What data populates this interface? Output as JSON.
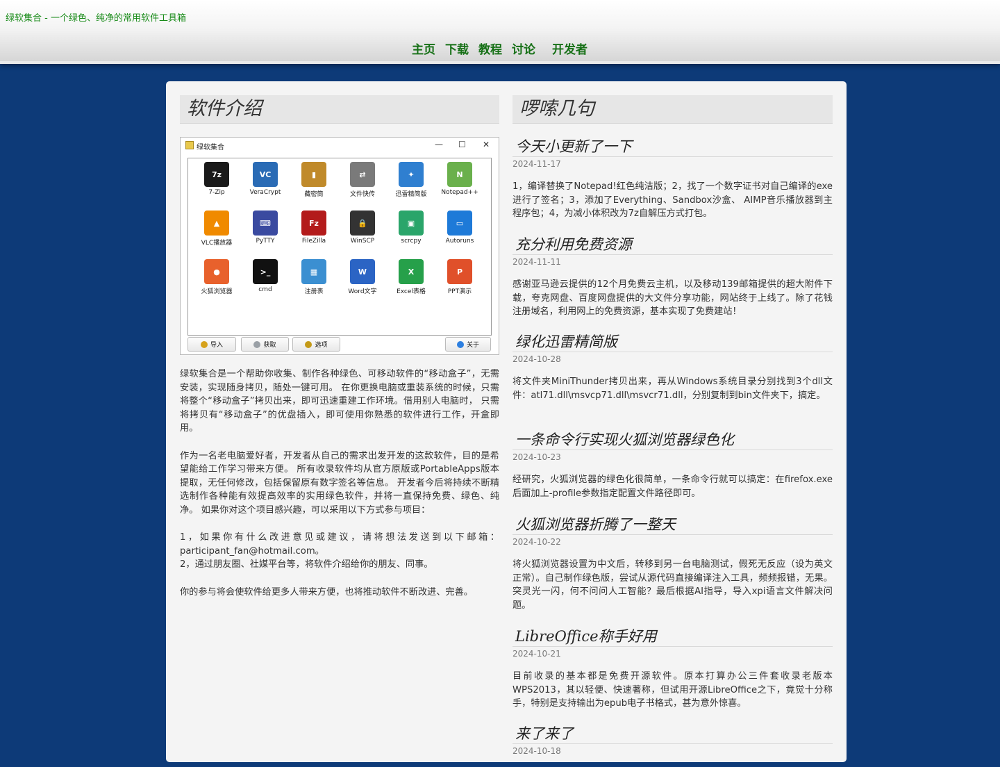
{
  "site": {
    "title": "绿软集合 - 一个绿色、纯净的常用软件工具箱",
    "nav": [
      "主页",
      "下载",
      "教程",
      "讨论",
      "开发者"
    ]
  },
  "left": {
    "heading": "软件介绍",
    "app": {
      "window_title": "绿软集合",
      "controls": [
        "—",
        "☐",
        "✕"
      ],
      "items": [
        {
          "label": "7-Zip",
          "icon": "7zip-icon",
          "color": "#1a1a1a",
          "glyph": "7z"
        },
        {
          "label": "VeraCrypt",
          "icon": "veracrypt-icon",
          "color": "#2a6bb5",
          "glyph": "VC"
        },
        {
          "label": "藏密筒",
          "icon": "safe-icon",
          "color": "#c08a2a",
          "glyph": "▮"
        },
        {
          "label": "文件快传",
          "icon": "file-transfer-icon",
          "color": "#7a7a7a",
          "glyph": "⇄"
        },
        {
          "label": "迅雷精简版",
          "icon": "thunder-bird-icon",
          "color": "#2f7fd0",
          "glyph": "✦"
        },
        {
          "label": "Notepad++",
          "icon": "notepad-icon",
          "color": "#6ab04c",
          "glyph": "N"
        },
        {
          "label": "VLC播放器",
          "icon": "vlc-cone-icon",
          "color": "#f08a00",
          "glyph": "▲"
        },
        {
          "label": "PyTTY",
          "icon": "terminal-icon",
          "color": "#3a4aa0",
          "glyph": "⌨"
        },
        {
          "label": "FileZilla",
          "icon": "filezilla-icon",
          "color": "#b31b1b",
          "glyph": "Fz"
        },
        {
          "label": "WinSCP",
          "icon": "lock-icon",
          "color": "#333333",
          "glyph": "🔒"
        },
        {
          "label": "scrcpy",
          "icon": "android-icon",
          "color": "#2aa56a",
          "glyph": "▣"
        },
        {
          "label": "Autoruns",
          "icon": "autoruns-icon",
          "color": "#1e7ad8",
          "glyph": "▭"
        },
        {
          "label": "火狐浏览器",
          "icon": "firefox-icon",
          "color": "#e8612c",
          "glyph": "●"
        },
        {
          "label": "cmd",
          "icon": "cmd-icon",
          "color": "#111111",
          "glyph": ">_"
        },
        {
          "label": "注册表",
          "icon": "registry-icon",
          "color": "#3b8fd1",
          "glyph": "▦"
        },
        {
          "label": "Word文字",
          "icon": "word-icon",
          "color": "#2b64c4",
          "glyph": "W"
        },
        {
          "label": "Excel表格",
          "icon": "excel-icon",
          "color": "#26a04a",
          "glyph": "X"
        },
        {
          "label": "PPT演示",
          "icon": "ppt-icon",
          "color": "#e0502a",
          "glyph": "P"
        }
      ],
      "buttons": [
        {
          "label": "导入",
          "color": "#d6a21c"
        },
        {
          "label": "获取",
          "color": "#9aa0a6"
        },
        {
          "label": "选项",
          "color": "#c49a17"
        },
        {
          "label": "关于",
          "color": "#2d7fe0"
        }
      ]
    },
    "paragraphs": [
      "绿软集合是一个帮助你收集、制作各种绿色、可移动软件的“移动盒子”，无需安装，实现随身拷贝，随处一键可用。 在你更换电脑或重装系统的时候，只需将整个“移动盒子”拷贝出来，即可迅速重建工作环境。借用别人电脑时， 只需将拷贝有“移动盒子”的优盘插入，即可使用你熟悉的软件进行工作，开盒即用。",
      "作为一名老电脑爱好者，开发者从自己的需求出发开发的这款软件，目的是希望能给工作学习带来方便。 所有收录软件均从官方原版或PortableApps版本提取，无任何修改，包括保留原有数字签名等信息。 开发者今后将持续不断精选制作各种能有效提高效率的实用绿色软件，并将一直保持免费、绿色、纯净。 如果你对这个项目感兴趣，可以采用以下方式参与项目：",
      "1，如果你有什么改进意见或建议，请将想法发送到以下邮箱：participant_fan@hotmail.com。",
      "2，通过朋友圈、社媒平台等，将软件介绍给你的朋友、同事。",
      "你的参与将会使软件给更多人带来方便，也将推动软件不断改进、完善。"
    ]
  },
  "right": {
    "heading": "啰嗦几句",
    "posts": [
      {
        "title": "今天小更新了一下",
        "date": "2024-11-17",
        "body": "1，编译替换了Notepad!红色纯洁版；2，找了一个数字证书对自己编译的exe进行了签名；3，添加了Everything、Sandbox沙盒、 AIMP音乐播放器到主程序包；4，为减小体积改为7z自解压方式打包。"
      },
      {
        "title": "充分利用免费资源",
        "date": "2024-11-11",
        "body": "感谢亚马逊云提供的12个月免费云主机，以及移动139邮箱提供的超大附件下载，夸克网盘、百度网盘提供的大文件分享功能，网站终于上线了。除了花钱注册域名，利用网上的免费资源，基本实现了免费建站！"
      },
      {
        "title": "绿化迅雷精简版",
        "date": "2024-10-28",
        "body": "将文件夹MiniThunder拷贝出来，再从Windows系统目录分别找到3个dll文件：atl71.dll\\msvcp71.dll\\msvcr71.dll，分别复制到bin文件夹下，搞定。"
      },
      {
        "title": "一条命令行实现火狐浏览器绿色化",
        "date": "2024-10-23",
        "body": "经研究，火狐浏览器的绿色化很简单，一条命令行就可以搞定：在firefox.exe后面加上-profile参数指定配置文件路径即可。"
      },
      {
        "title": "火狐浏览器折腾了一整天",
        "date": "2024-10-22",
        "body": "将火狐浏览器设置为中文后，转移到另一台电脑测试，假死无反应（设为英文正常）。自己制作绿色版，尝试从源代码直接编译注入工具，频频报错，无果。突灵光一闪，何不问问人工智能？最后根据AI指导，导入xpi语言文件解决问题。"
      },
      {
        "title": "LibreOffice称手好用",
        "date": "2024-10-21",
        "body": "目前收录的基本都是免费开源软件。原本打算办公三件套收录老版本WPS2013，其以轻便、快速著称，但试用开源LibreOffice之下，竟觉十分称手，特别是支持输出为epub电子书格式，甚为意外惊喜。"
      },
      {
        "title": "来了来了",
        "date": "2024-10-18",
        "body": ""
      }
    ]
  }
}
